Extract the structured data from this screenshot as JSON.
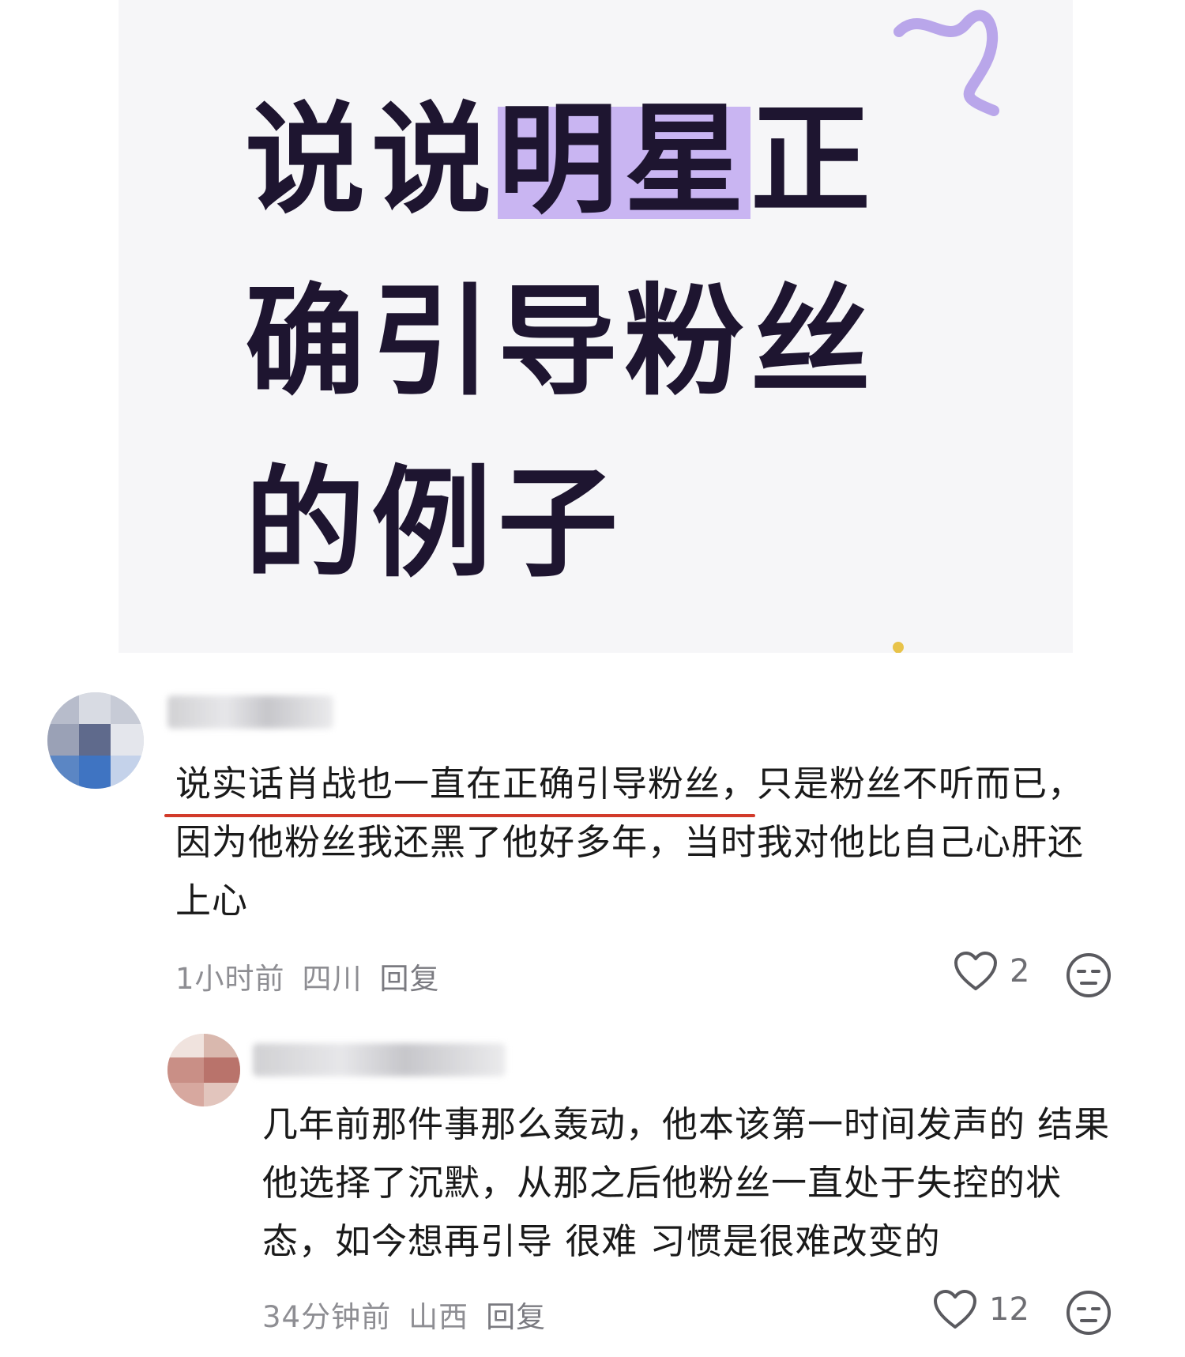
{
  "cover": {
    "line1_a": "说说",
    "line1_hl": "明星",
    "line1_b": "正",
    "line2": "确引导粉丝",
    "line3": "的例子"
  },
  "comments": [
    {
      "text": "说实话肖战也一直在正确引导粉丝，只是粉丝不听而已，因为他粉丝我还黑了他好多年，当时我对他比自己心肝还上心",
      "time": "1小时前",
      "location": "四川",
      "reply_label": "回复",
      "likes": "2",
      "like_icon": "heart-outline-icon",
      "react_icon": "neutral-face-icon"
    },
    {
      "text": "几年前那件事那么轰动，他本该第一时间发声的 结果他选择了沉默，从那之后他粉丝一直处于失控的状态，如今想再引导 很难 习惯是很难改变的",
      "time": "34分钟前",
      "location": "山西",
      "reply_label": "回复",
      "likes": "12",
      "like_icon": "heart-outline-icon",
      "react_icon": "neutral-face-icon"
    }
  ],
  "colors": {
    "highlight": "#c9b5f2",
    "title": "#1e1530",
    "underline": "#d23a2a",
    "meta": "#8e8e93"
  }
}
